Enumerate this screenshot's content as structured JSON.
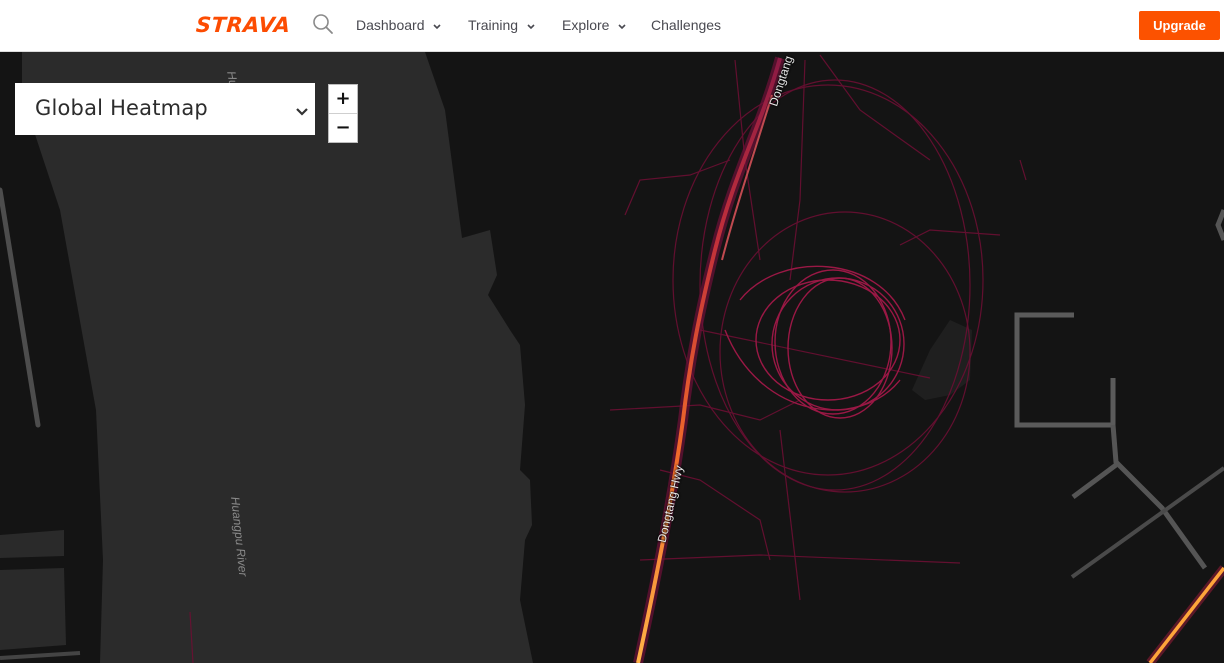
{
  "header": {
    "logo": "STRAVA",
    "nav": [
      {
        "label": "Dashboard",
        "dropdown": true
      },
      {
        "label": "Training",
        "dropdown": true
      },
      {
        "label": "Explore",
        "dropdown": true
      },
      {
        "label": "Challenges",
        "dropdown": false
      }
    ],
    "upgrade_label": "Upgrade"
  },
  "map": {
    "layer_select": {
      "selected": "Global Heatmap"
    },
    "zoom_in_label": "+",
    "zoom_out_label": "−",
    "labels": {
      "river_main": "Huangpu River",
      "river_top": "Huangp",
      "road_lower": "Dongtang Hwy",
      "road_upper": "Dongtang"
    }
  },
  "colors": {
    "brand": "#fc4c02",
    "upgrade_bg": "#fc5200",
    "map_background": "#141414",
    "river": "#2b2b2b",
    "heat_low": "#7a0f3a",
    "heat_mid": "#e0452a",
    "heat_high": "#ffd36a"
  },
  "icons": {
    "search": "search-icon",
    "dropdown": "chevron-down-icon"
  }
}
